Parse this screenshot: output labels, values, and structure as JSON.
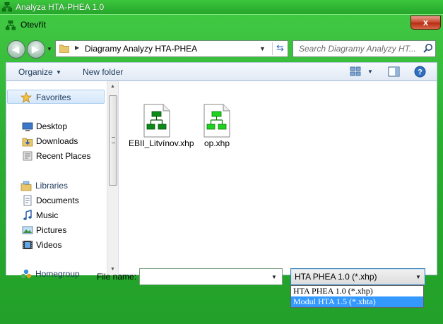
{
  "app": {
    "title": "Analýza HTA-PHEA 1.0"
  },
  "dialog": {
    "title": "Otevřít",
    "close_label": "x"
  },
  "address": {
    "path": "Diagramy Analyzy HTA-PHEA"
  },
  "search": {
    "placeholder": "Search Diagramy Analyzy HT..."
  },
  "toolbar": {
    "organize": "Organize",
    "new_folder": "New folder"
  },
  "sidebar": {
    "favorites": "Favorites",
    "favorites_items": [
      "Desktop",
      "Downloads",
      "Recent Places"
    ],
    "libraries": "Libraries",
    "libraries_items": [
      "Documents",
      "Music",
      "Pictures",
      "Videos"
    ],
    "homegroup": "Homegroup"
  },
  "files": [
    {
      "name": "EBII_Litvínov.xhp"
    },
    {
      "name": "op.xhp"
    }
  ],
  "file_name": {
    "label": "File name:",
    "value": ""
  },
  "file_type": {
    "selected": "HTA PHEA 1.0 (*.xhp)",
    "options": [
      "HTA PHEA 1.0 (*.xhp)",
      "Modul HTA 1.5 (*.xhta)"
    ],
    "highlighted_index": 1
  },
  "colors": {
    "frame_green": "#2cae32",
    "selection_blue": "#3399ff",
    "close_red": "#c7432a"
  }
}
